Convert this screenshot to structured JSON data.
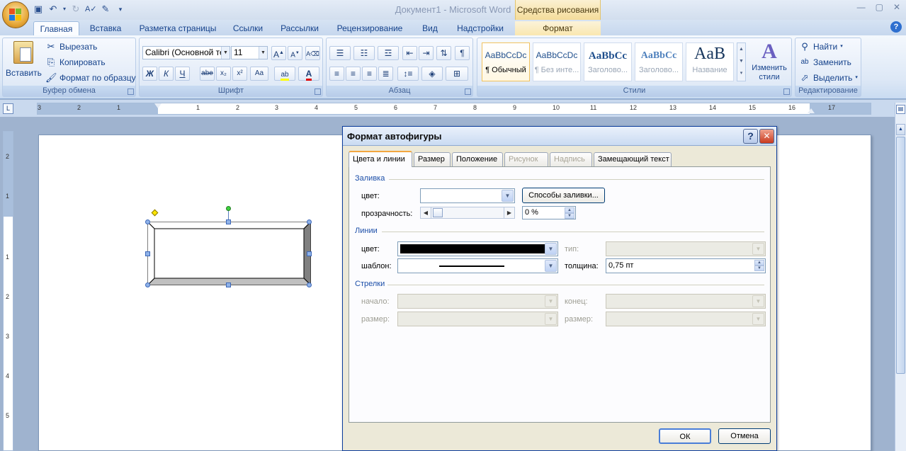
{
  "window": {
    "title": "Документ1 - Microsoft Word",
    "contextual_tab_group": "Средства рисования"
  },
  "tabs": [
    {
      "label": "Главная",
      "active": true
    },
    {
      "label": "Вставка"
    },
    {
      "label": "Разметка страницы"
    },
    {
      "label": "Ссылки"
    },
    {
      "label": "Рассылки"
    },
    {
      "label": "Рецензирование"
    },
    {
      "label": "Вид"
    },
    {
      "label": "Надстройки"
    },
    {
      "label": "Формат",
      "contextual": true
    }
  ],
  "ribbon": {
    "clipboard": {
      "label": "Буфер обмена",
      "paste": "Вставить",
      "cut": "Вырезать",
      "copy": "Копировать",
      "format_painter": "Формат по образцу"
    },
    "font": {
      "label": "Шрифт",
      "font_name": "Calibri (Основной те",
      "font_size": "11",
      "bold": "Ж",
      "italic": "К",
      "underline": "Ч",
      "strike": "abe",
      "subscript": "x₂",
      "superscript": "x²",
      "change_case": "Aa",
      "grow": "A",
      "shrink": "A"
    },
    "paragraph": {
      "label": "Абзац"
    },
    "styles": {
      "label": "Стили",
      "items": [
        {
          "sample": "AaBbCcDc",
          "name": "¶ Обычный"
        },
        {
          "sample": "AaBbCcDc",
          "name": "¶ Без инте..."
        },
        {
          "sample": "AaBbCc",
          "name": "Заголово..."
        },
        {
          "sample": "AaBbCc",
          "name": "Заголово..."
        },
        {
          "sample": "AaB",
          "name": "Название"
        }
      ],
      "change_styles": "Изменить стили"
    },
    "editing": {
      "label": "Редактирование",
      "find": "Найти",
      "replace": "Заменить",
      "select": "Выделить"
    }
  },
  "ruler": {
    "h_numbers": [
      "3",
      "2",
      "1",
      "1",
      "2",
      "3",
      "4",
      "5",
      "6",
      "7",
      "8",
      "9",
      "10",
      "11",
      "12",
      "13",
      "14",
      "15",
      "16",
      "17"
    ],
    "v_numbers": [
      "2",
      "1",
      "1",
      "2",
      "3",
      "4",
      "5"
    ],
    "corner": "L"
  },
  "dialog": {
    "title": "Формат автофигуры",
    "help": "?",
    "close": "✕",
    "tabs": [
      {
        "label": "Цвета и линии",
        "active": true
      },
      {
        "label": "Размер"
      },
      {
        "label": "Положение"
      },
      {
        "label": "Рисунок",
        "disabled": true
      },
      {
        "label": "Надпись",
        "disabled": true
      },
      {
        "label": "Замещающий текст"
      }
    ],
    "fill": {
      "section": "Заливка",
      "color_label": "цвет:",
      "fill_effects": "Способы заливки...",
      "transparency_label": "прозрачность:",
      "transparency_value": "0 %",
      "transparency_fraction": 0
    },
    "lines": {
      "section": "Линии",
      "color_label": "цвет:",
      "color_value": "#000000",
      "type_label": "тип:",
      "pattern_label": "шаблон:",
      "weight_label": "толщина:",
      "weight_value": "0,75 пт"
    },
    "arrows": {
      "section": "Стрелки",
      "begin_label": "начало:",
      "end_label": "конец:",
      "begin_size_label": "размер:",
      "end_size_label": "размер:"
    },
    "ok": "ОК",
    "cancel": "Отмена"
  }
}
